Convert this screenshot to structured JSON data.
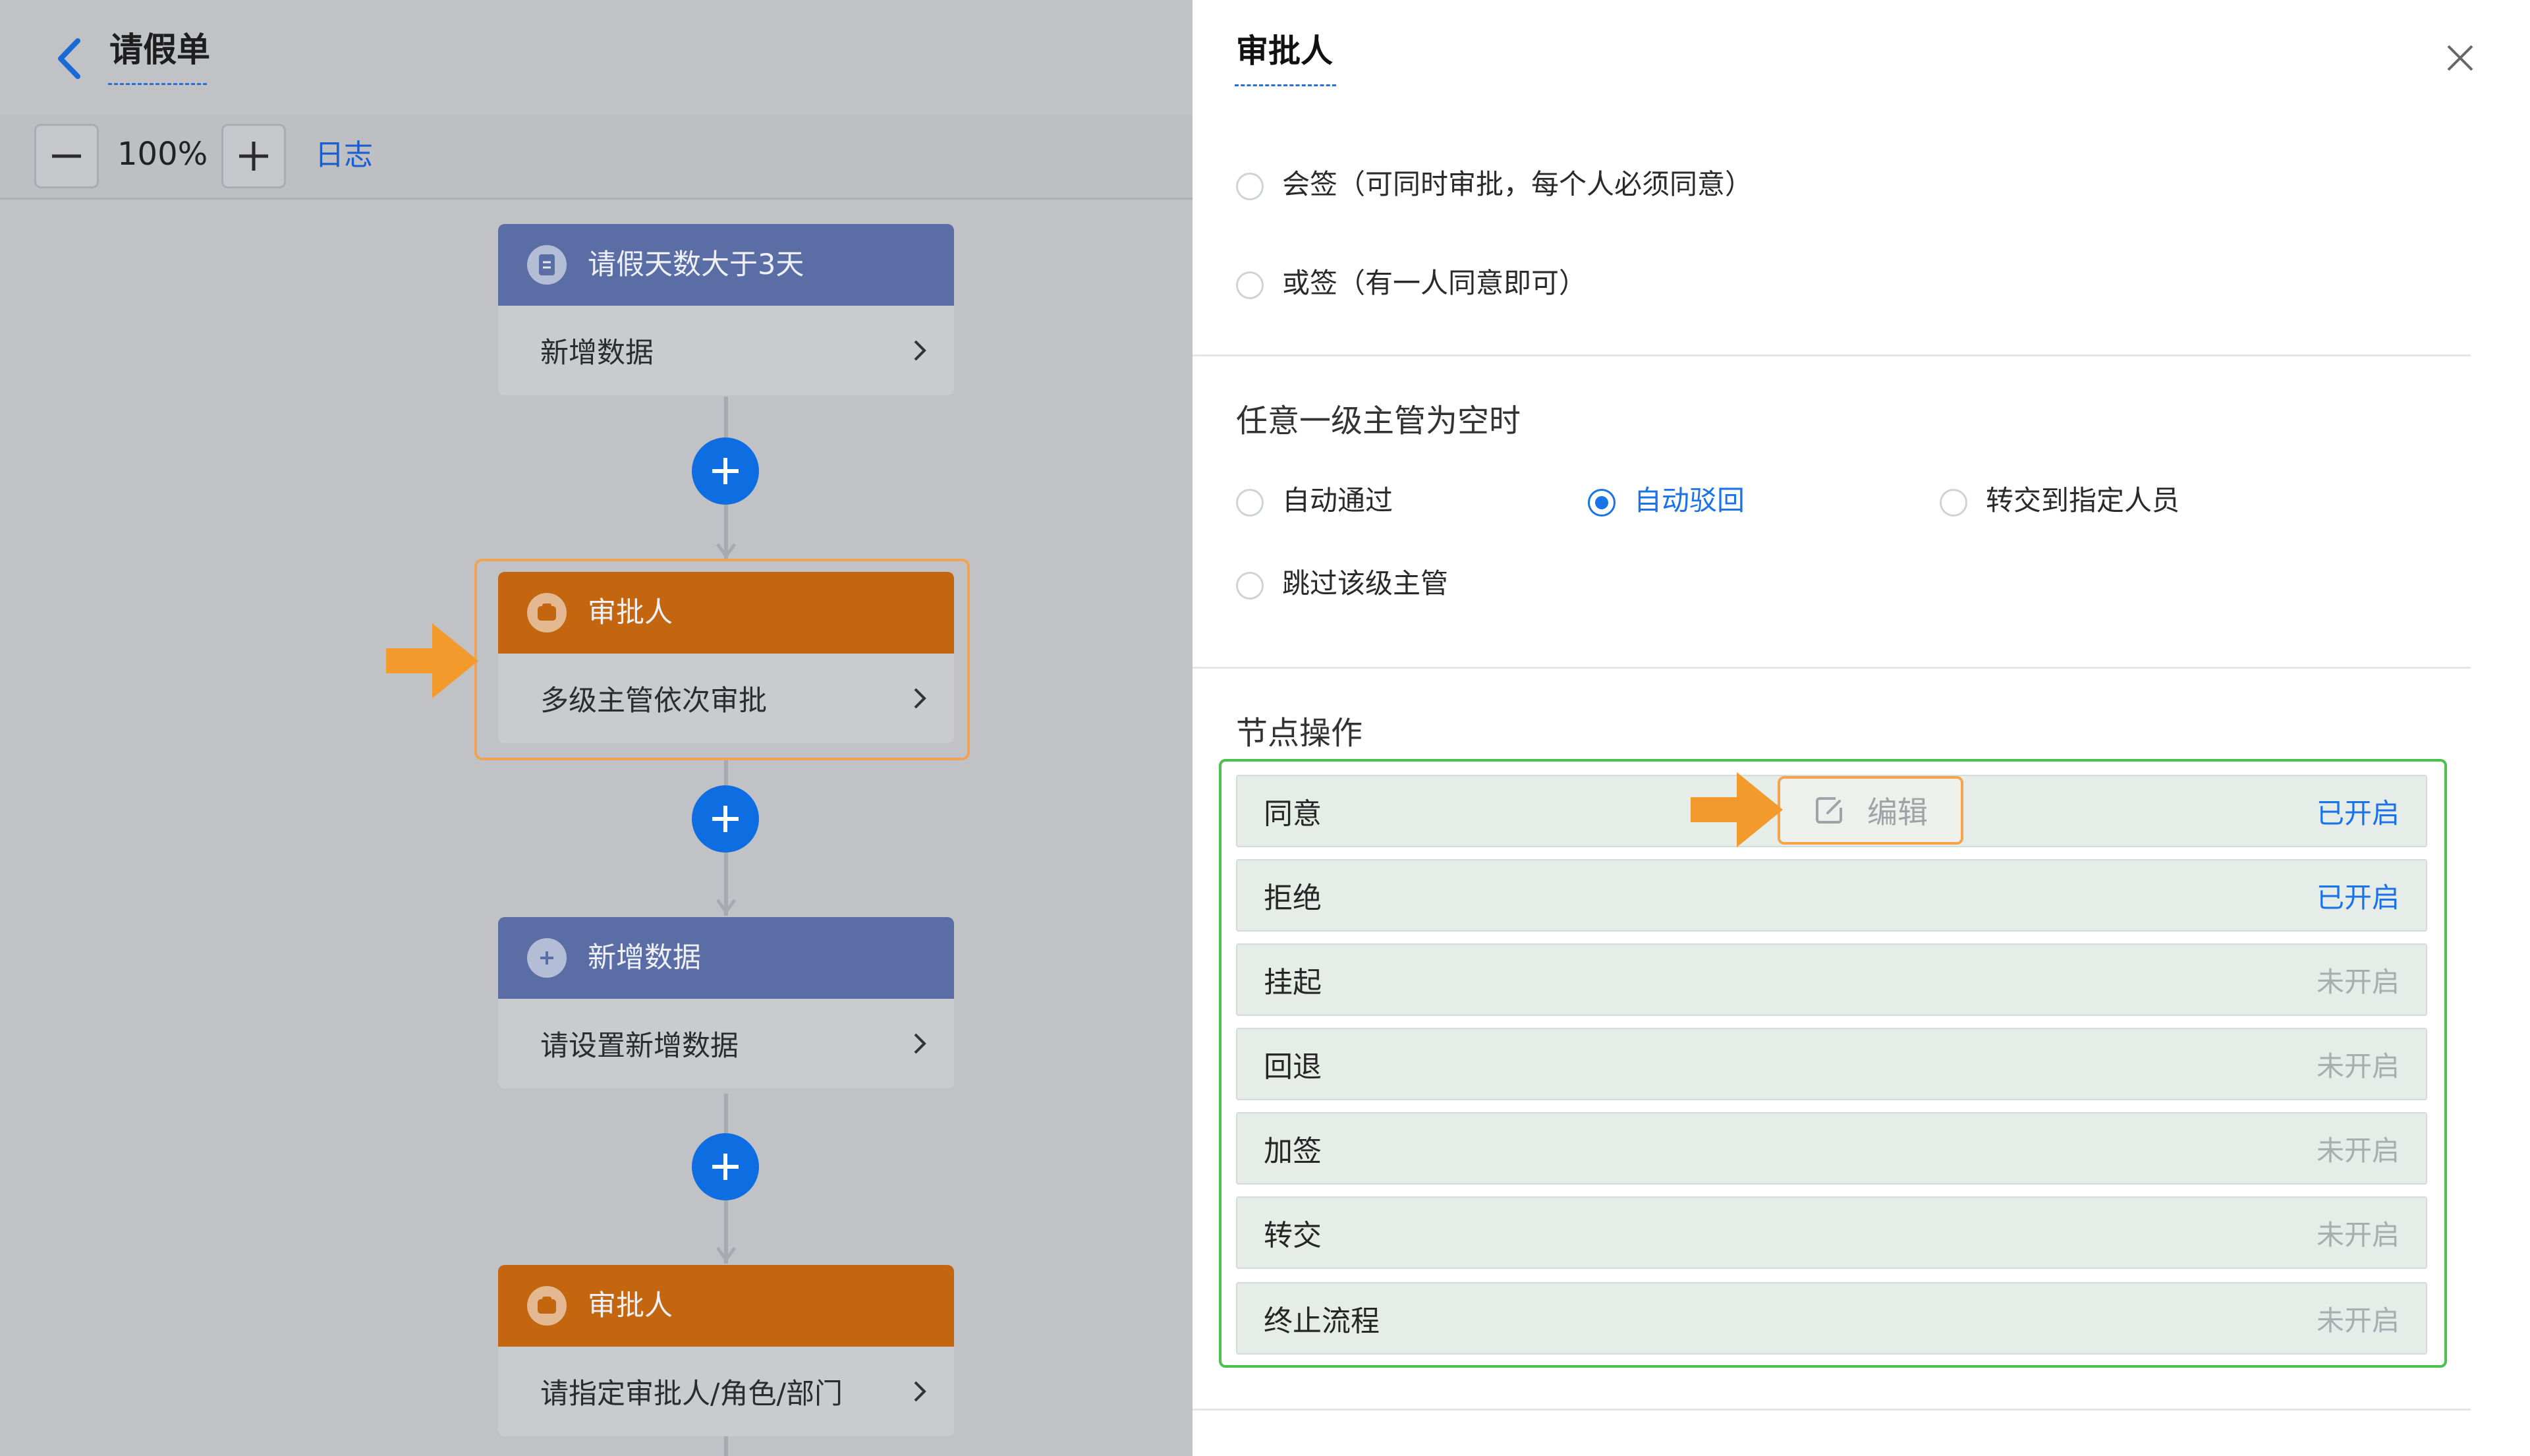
{
  "header": {
    "title": "请假单"
  },
  "toolbar": {
    "zoom": "100%",
    "log_label": "日志"
  },
  "nodes": [
    {
      "header": "请假天数大于3天",
      "body": "新增数据"
    },
    {
      "header": "审批人",
      "body": "多级主管依次审批"
    },
    {
      "header": "新增数据",
      "body": "请设置新增数据"
    },
    {
      "header": "审批人",
      "body": "请指定审批人/角色/部门"
    }
  ],
  "panel": {
    "title": "审批人",
    "sign_modes": [
      "会签（可同时审批，每个人必须同意）",
      "或签（有一人同意即可）"
    ],
    "empty_manager": {
      "label": "任意一级主管为空时",
      "options": [
        "自动通过",
        "自动驳回",
        "转交到指定人员",
        "跳过该级主管"
      ],
      "selected": "自动驳回"
    },
    "node_ops": {
      "label": "节点操作",
      "edit_label": "编辑",
      "items": [
        {
          "name": "同意",
          "status": "已开启"
        },
        {
          "name": "拒绝",
          "status": "已开启"
        },
        {
          "name": "挂起",
          "status": "未开启"
        },
        {
          "name": "回退",
          "status": "未开启"
        },
        {
          "name": "加签",
          "status": "未开启"
        },
        {
          "name": "转交",
          "status": "未开启"
        },
        {
          "name": "终止流程",
          "status": "未开启"
        }
      ]
    }
  },
  "colors": {
    "accent": "#1a73e8",
    "orange_node": "#c4650f",
    "blue_node": "#5a6ea5",
    "highlight_green": "#4cc14c",
    "highlight_orange": "#f3a44d"
  },
  "icons": [
    "back-arrow-icon",
    "zoom-out-icon",
    "zoom-in-icon",
    "document-icon",
    "approver-icon",
    "plus-circle-icon",
    "chevron-right-icon",
    "close-icon",
    "edit-icon",
    "pointer-arrow-icon"
  ]
}
